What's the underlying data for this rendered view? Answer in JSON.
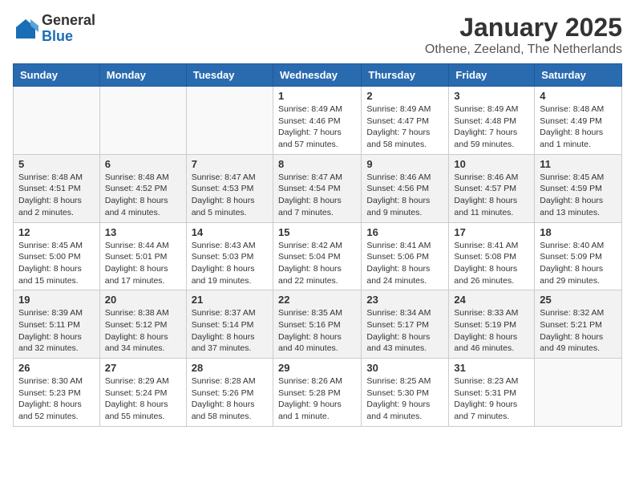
{
  "header": {
    "logo_general": "General",
    "logo_blue": "Blue",
    "month_year": "January 2025",
    "location": "Othene, Zeeland, The Netherlands"
  },
  "weekdays": [
    "Sunday",
    "Monday",
    "Tuesday",
    "Wednesday",
    "Thursday",
    "Friday",
    "Saturday"
  ],
  "weeks": [
    {
      "shaded": false,
      "days": [
        {
          "num": "",
          "info": ""
        },
        {
          "num": "",
          "info": ""
        },
        {
          "num": "",
          "info": ""
        },
        {
          "num": "1",
          "info": "Sunrise: 8:49 AM\nSunset: 4:46 PM\nDaylight: 7 hours\nand 57 minutes."
        },
        {
          "num": "2",
          "info": "Sunrise: 8:49 AM\nSunset: 4:47 PM\nDaylight: 7 hours\nand 58 minutes."
        },
        {
          "num": "3",
          "info": "Sunrise: 8:49 AM\nSunset: 4:48 PM\nDaylight: 7 hours\nand 59 minutes."
        },
        {
          "num": "4",
          "info": "Sunrise: 8:48 AM\nSunset: 4:49 PM\nDaylight: 8 hours\nand 1 minute."
        }
      ]
    },
    {
      "shaded": true,
      "days": [
        {
          "num": "5",
          "info": "Sunrise: 8:48 AM\nSunset: 4:51 PM\nDaylight: 8 hours\nand 2 minutes."
        },
        {
          "num": "6",
          "info": "Sunrise: 8:48 AM\nSunset: 4:52 PM\nDaylight: 8 hours\nand 4 minutes."
        },
        {
          "num": "7",
          "info": "Sunrise: 8:47 AM\nSunset: 4:53 PM\nDaylight: 8 hours\nand 5 minutes."
        },
        {
          "num": "8",
          "info": "Sunrise: 8:47 AM\nSunset: 4:54 PM\nDaylight: 8 hours\nand 7 minutes."
        },
        {
          "num": "9",
          "info": "Sunrise: 8:46 AM\nSunset: 4:56 PM\nDaylight: 8 hours\nand 9 minutes."
        },
        {
          "num": "10",
          "info": "Sunrise: 8:46 AM\nSunset: 4:57 PM\nDaylight: 8 hours\nand 11 minutes."
        },
        {
          "num": "11",
          "info": "Sunrise: 8:45 AM\nSunset: 4:59 PM\nDaylight: 8 hours\nand 13 minutes."
        }
      ]
    },
    {
      "shaded": false,
      "days": [
        {
          "num": "12",
          "info": "Sunrise: 8:45 AM\nSunset: 5:00 PM\nDaylight: 8 hours\nand 15 minutes."
        },
        {
          "num": "13",
          "info": "Sunrise: 8:44 AM\nSunset: 5:01 PM\nDaylight: 8 hours\nand 17 minutes."
        },
        {
          "num": "14",
          "info": "Sunrise: 8:43 AM\nSunset: 5:03 PM\nDaylight: 8 hours\nand 19 minutes."
        },
        {
          "num": "15",
          "info": "Sunrise: 8:42 AM\nSunset: 5:04 PM\nDaylight: 8 hours\nand 22 minutes."
        },
        {
          "num": "16",
          "info": "Sunrise: 8:41 AM\nSunset: 5:06 PM\nDaylight: 8 hours\nand 24 minutes."
        },
        {
          "num": "17",
          "info": "Sunrise: 8:41 AM\nSunset: 5:08 PM\nDaylight: 8 hours\nand 26 minutes."
        },
        {
          "num": "18",
          "info": "Sunrise: 8:40 AM\nSunset: 5:09 PM\nDaylight: 8 hours\nand 29 minutes."
        }
      ]
    },
    {
      "shaded": true,
      "days": [
        {
          "num": "19",
          "info": "Sunrise: 8:39 AM\nSunset: 5:11 PM\nDaylight: 8 hours\nand 32 minutes."
        },
        {
          "num": "20",
          "info": "Sunrise: 8:38 AM\nSunset: 5:12 PM\nDaylight: 8 hours\nand 34 minutes."
        },
        {
          "num": "21",
          "info": "Sunrise: 8:37 AM\nSunset: 5:14 PM\nDaylight: 8 hours\nand 37 minutes."
        },
        {
          "num": "22",
          "info": "Sunrise: 8:35 AM\nSunset: 5:16 PM\nDaylight: 8 hours\nand 40 minutes."
        },
        {
          "num": "23",
          "info": "Sunrise: 8:34 AM\nSunset: 5:17 PM\nDaylight: 8 hours\nand 43 minutes."
        },
        {
          "num": "24",
          "info": "Sunrise: 8:33 AM\nSunset: 5:19 PM\nDaylight: 8 hours\nand 46 minutes."
        },
        {
          "num": "25",
          "info": "Sunrise: 8:32 AM\nSunset: 5:21 PM\nDaylight: 8 hours\nand 49 minutes."
        }
      ]
    },
    {
      "shaded": false,
      "days": [
        {
          "num": "26",
          "info": "Sunrise: 8:30 AM\nSunset: 5:23 PM\nDaylight: 8 hours\nand 52 minutes."
        },
        {
          "num": "27",
          "info": "Sunrise: 8:29 AM\nSunset: 5:24 PM\nDaylight: 8 hours\nand 55 minutes."
        },
        {
          "num": "28",
          "info": "Sunrise: 8:28 AM\nSunset: 5:26 PM\nDaylight: 8 hours\nand 58 minutes."
        },
        {
          "num": "29",
          "info": "Sunrise: 8:26 AM\nSunset: 5:28 PM\nDaylight: 9 hours\nand 1 minute."
        },
        {
          "num": "30",
          "info": "Sunrise: 8:25 AM\nSunset: 5:30 PM\nDaylight: 9 hours\nand 4 minutes."
        },
        {
          "num": "31",
          "info": "Sunrise: 8:23 AM\nSunset: 5:31 PM\nDaylight: 9 hours\nand 7 minutes."
        },
        {
          "num": "",
          "info": ""
        }
      ]
    }
  ]
}
